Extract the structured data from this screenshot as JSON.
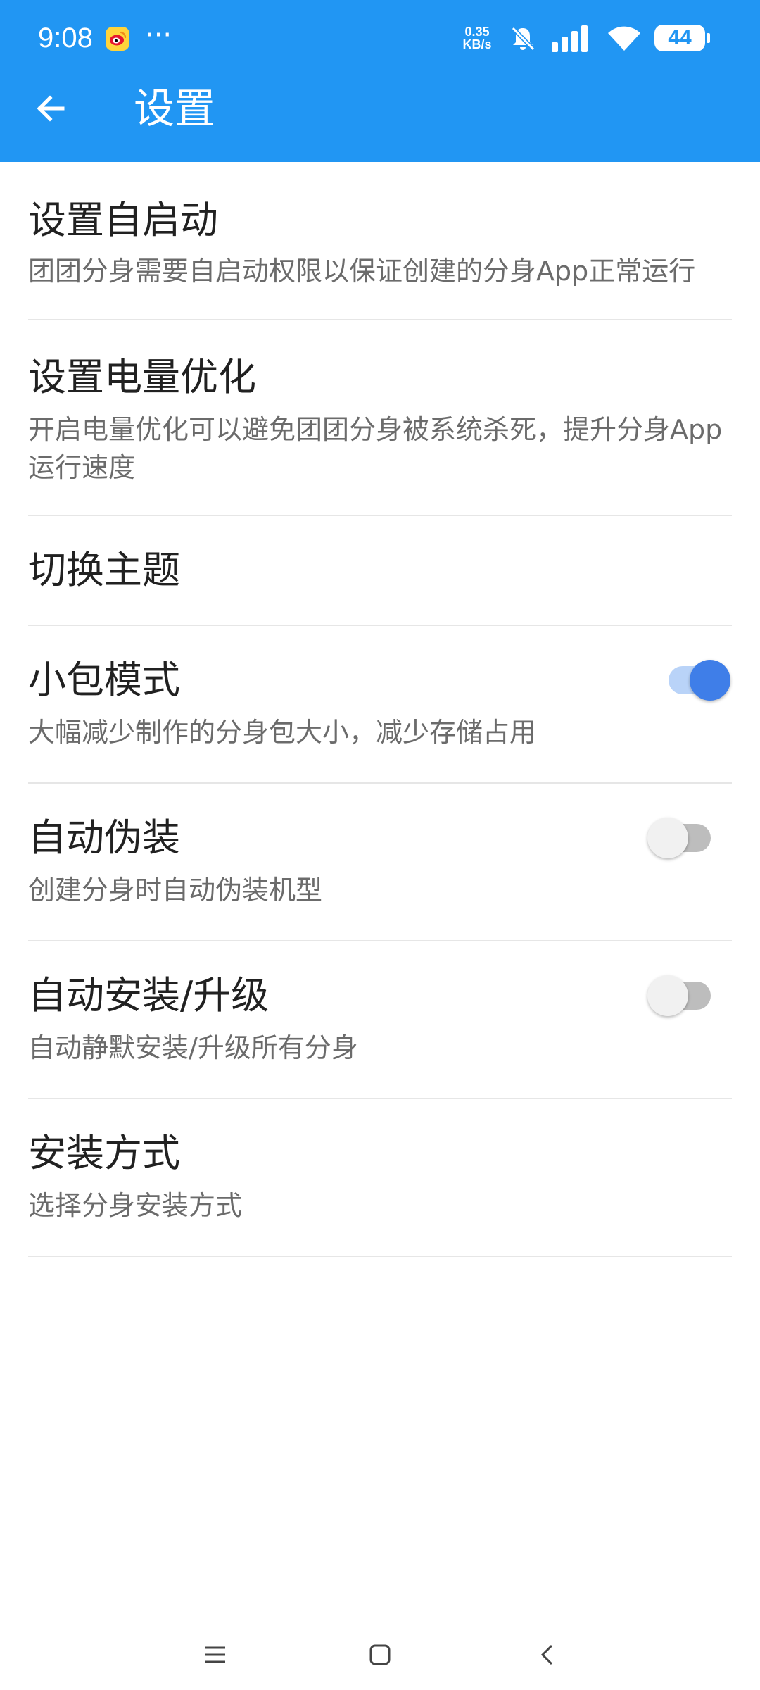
{
  "theme": {
    "primary": "#2196f3",
    "switch_on_thumb": "#3f7ee8",
    "switch_on_track": "#b9d3f8"
  },
  "status_bar": {
    "time": "9:08",
    "more": "···",
    "net_speed_value": "0.35",
    "net_speed_unit": "KB/s",
    "battery": "44",
    "icons": [
      "weibo-icon",
      "bell-off-icon",
      "signal-icon",
      "wifi-icon",
      "battery-icon"
    ]
  },
  "toolbar": {
    "back_icon": "arrow-left-icon",
    "title": "设置"
  },
  "settings": [
    {
      "title": "设置自启动",
      "subtitle": "团团分身需要自启动权限以保证创建的分身App正常运行"
    },
    {
      "title": "设置电量优化",
      "subtitle": "开启电量优化可以避免团团分身被系统杀死，提升分身App运行速度"
    },
    {
      "title": "切换主题"
    },
    {
      "title": "小包模式",
      "subtitle": "大幅减少制作的分身包大小，减少存储占用",
      "toggle": true
    },
    {
      "title": "自动伪装",
      "subtitle": "创建分身时自动伪装机型",
      "toggle": false
    },
    {
      "title": "自动安装/升级",
      "subtitle": "自动静默安装/升级所有分身",
      "toggle": false
    },
    {
      "title": "安装方式",
      "subtitle": "选择分身安装方式"
    }
  ],
  "nav_bar": {
    "icons": [
      "menu-icon",
      "home-icon",
      "back-icon"
    ]
  }
}
